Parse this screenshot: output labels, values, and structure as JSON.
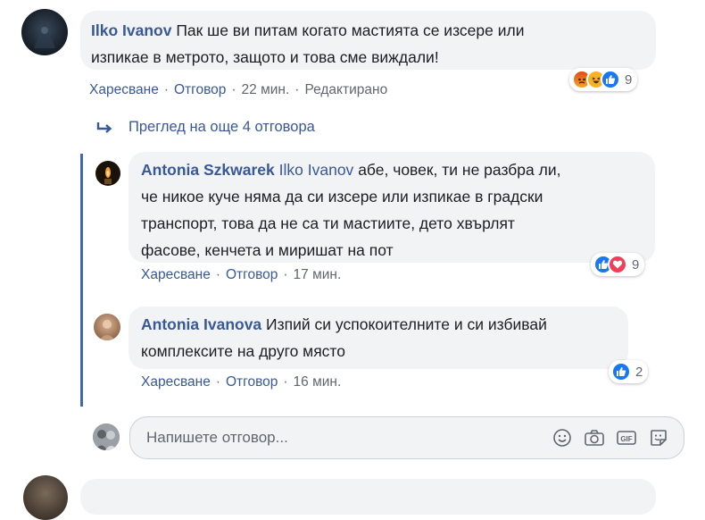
{
  "comment1": {
    "author": "Ilko Ivanov",
    "text_line1": "Пак ше ви питам когато мастията се изсере или",
    "text_line2": "изпикае в метрото, защото и това сме виждали!",
    "actions": {
      "like": "Харесване",
      "reply": "Отговор",
      "time": "22 мин.",
      "edited": "Редактирано"
    },
    "reaction_icons": [
      "angry-icon",
      "haha-icon",
      "like-icon"
    ],
    "reaction_count": "9"
  },
  "more_replies": {
    "label": "Преглед на още 4 отговора"
  },
  "reply1": {
    "author": "Antonia Szkwarek",
    "mention": "Ilko Ivanov",
    "text_line1": "абе, човек, ти не разбра ли,",
    "text_line2": "че никое куче няма да си изсере или изпикае в градски",
    "text_line3": "транспорт, това да не са ти мастиите, дето хвърлят",
    "text_line4": "фасове, кенчета и миришат на пот",
    "actions": {
      "like": "Харесване",
      "reply": "Отговор",
      "time": "17 мин."
    },
    "reaction_icons": [
      "like-icon",
      "love-icon"
    ],
    "reaction_count": "9"
  },
  "reply2": {
    "author": "Antonia Ivanova",
    "text_line1": "Изпий си успокоителните и си избивай",
    "text_line2": "комплексите на друго място",
    "actions": {
      "like": "Харесване",
      "reply": "Отговор",
      "time": "16 мин."
    },
    "reaction_icons": [
      "like-icon"
    ],
    "reaction_count": "2"
  },
  "reply_box": {
    "placeholder": "Напишете отговор...",
    "tools": [
      "emoji-icon",
      "camera-icon",
      "gif-icon",
      "sticker-icon"
    ]
  },
  "colors": {
    "link": "#385898",
    "like": "#1877f2",
    "love": "#f33e58",
    "angry": "#e9710f",
    "haha": "#f7b125",
    "bubble": "#f2f3f5",
    "thread_line": "#4267b2"
  }
}
